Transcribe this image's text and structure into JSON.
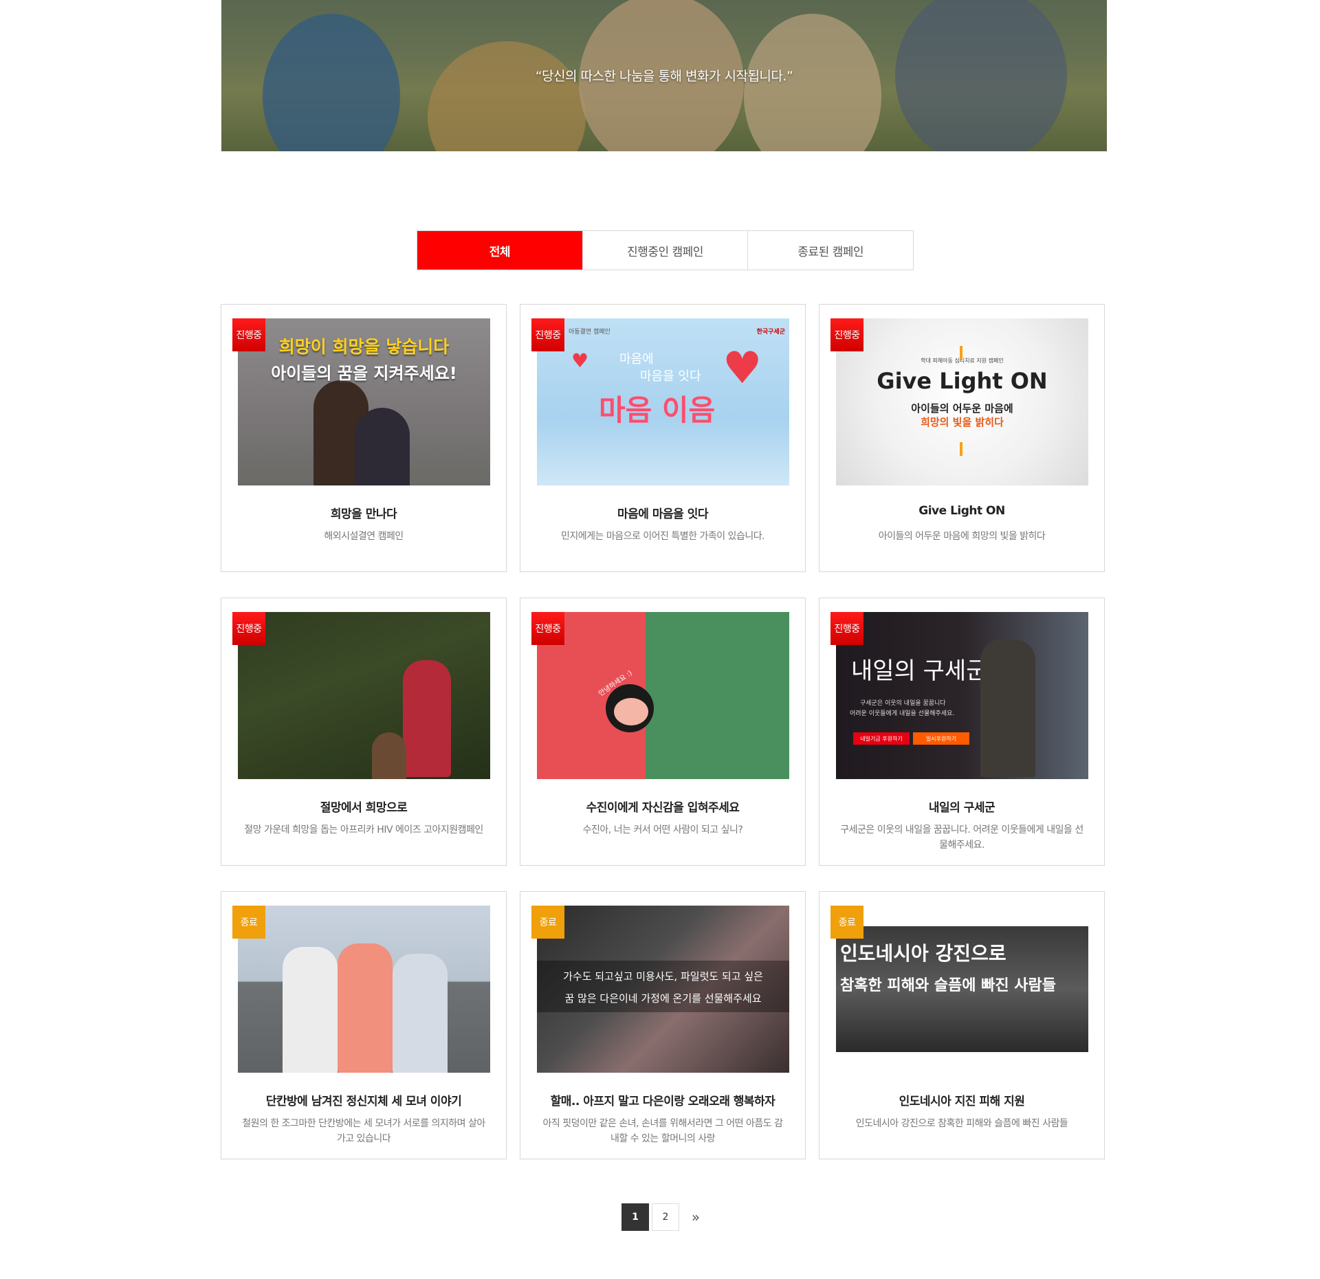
{
  "hero": {
    "quote": "“당신의 따스한 나눔을 통해 변화가 시작됩니다.”"
  },
  "tabs": [
    {
      "label": "전체"
    },
    {
      "label": "진행중인 캠페인"
    },
    {
      "label": "종료된 캠페인"
    }
  ],
  "cards": [
    {
      "badge": "진행중",
      "title": "희망을 만나다",
      "desc": "해외시설결연 캠페인",
      "img": {
        "line1": "희망이 희망을 낳습니다",
        "line2": "아이들의 꿈을 지켜주세요!"
      }
    },
    {
      "badge": "진행중",
      "title": "마음에 마음을 잇다",
      "desc": "민지에게는 마음으로 이어진 특별한 가족이 있습니다.",
      "img": {
        "small1": "아동결연 캠페인",
        "brand": "한국구세군",
        "line1": "마음에",
        "line2": "마음을 잇다",
        "line3": "마음 이음"
      }
    },
    {
      "badge": "진행중",
      "title": "Give Light ON",
      "desc": "아이들의 어두운 마음에 희망의 빛을 밝히다",
      "img": {
        "small1": "학대 피해아동 심리치료 지원 캠페인",
        "line1": "Give Light ON",
        "line2": "아이들의 어두운 마음에",
        "line3": "희망의 빛을 밝히다"
      }
    },
    {
      "badge": "진행중",
      "title": "절망에서 희망으로",
      "desc": "절망 가운데 희망을 돕는 아프리카 HIV 에이즈 고아지원캠페인"
    },
    {
      "badge": "진행중",
      "title": "수진이에게 자신감을 입혀주세요",
      "desc": "수진아, 너는 커서 어떤 사람이 되고 싶니?",
      "img": {
        "small1": "안녕하세요 :)"
      }
    },
    {
      "badge": "진행중",
      "title": "내일의 구세군",
      "desc": "구세군은 이웃의 내일을 꿈꿉니다. 어려운 이웃들에게 내일을 선물해주세요.",
      "img": {
        "line1": "내일의 구세군",
        "small1": "구세군은 이웃의 내일을 꿈꿉니다",
        "small2": "어려운 이웃들에게 내일을 선물해주세요.",
        "btn1": "내일기금 후원하기",
        "btn2": "일시후원하기"
      }
    },
    {
      "badge": "종료",
      "title": "단칸방에 남겨진 정신지체 세 모녀 이야기",
      "desc": "철원의 한 조그마한 단칸방에는 세 모녀가 서로를 의지하며 살아가고 있습니다"
    },
    {
      "badge": "종료",
      "title": "할매.. 아프지 말고 다은이랑 오래오래 행복하자",
      "desc": "아직 핏덩이만 같은 손녀, 손녀를 위해서라면 그 어떤 아픔도 감내할 수 있는 할머니의 사랑",
      "img": {
        "line1": "가수도 되고싶고 미용사도, 파일럿도 되고 싶은",
        "line2": "꿈 많은 다은이네 가정에 온기를 선물해주세요"
      }
    },
    {
      "badge": "종료",
      "title": "인도네시아 지진 피해 지원",
      "desc": "인도네시아 강진으로 참혹한 피해와 슬픔에 빠진 사람들",
      "img": {
        "line1": "인도네시아 강진으로",
        "line2": "참혹한 피해와 슬픔에 빠진 사람들"
      }
    }
  ],
  "pagination": {
    "pages": [
      "1",
      "2"
    ],
    "current": "1",
    "next": "»"
  },
  "colors": {
    "accent": "#ff0000",
    "badge_on": "#e60000",
    "badge_off": "#f0a00b"
  }
}
